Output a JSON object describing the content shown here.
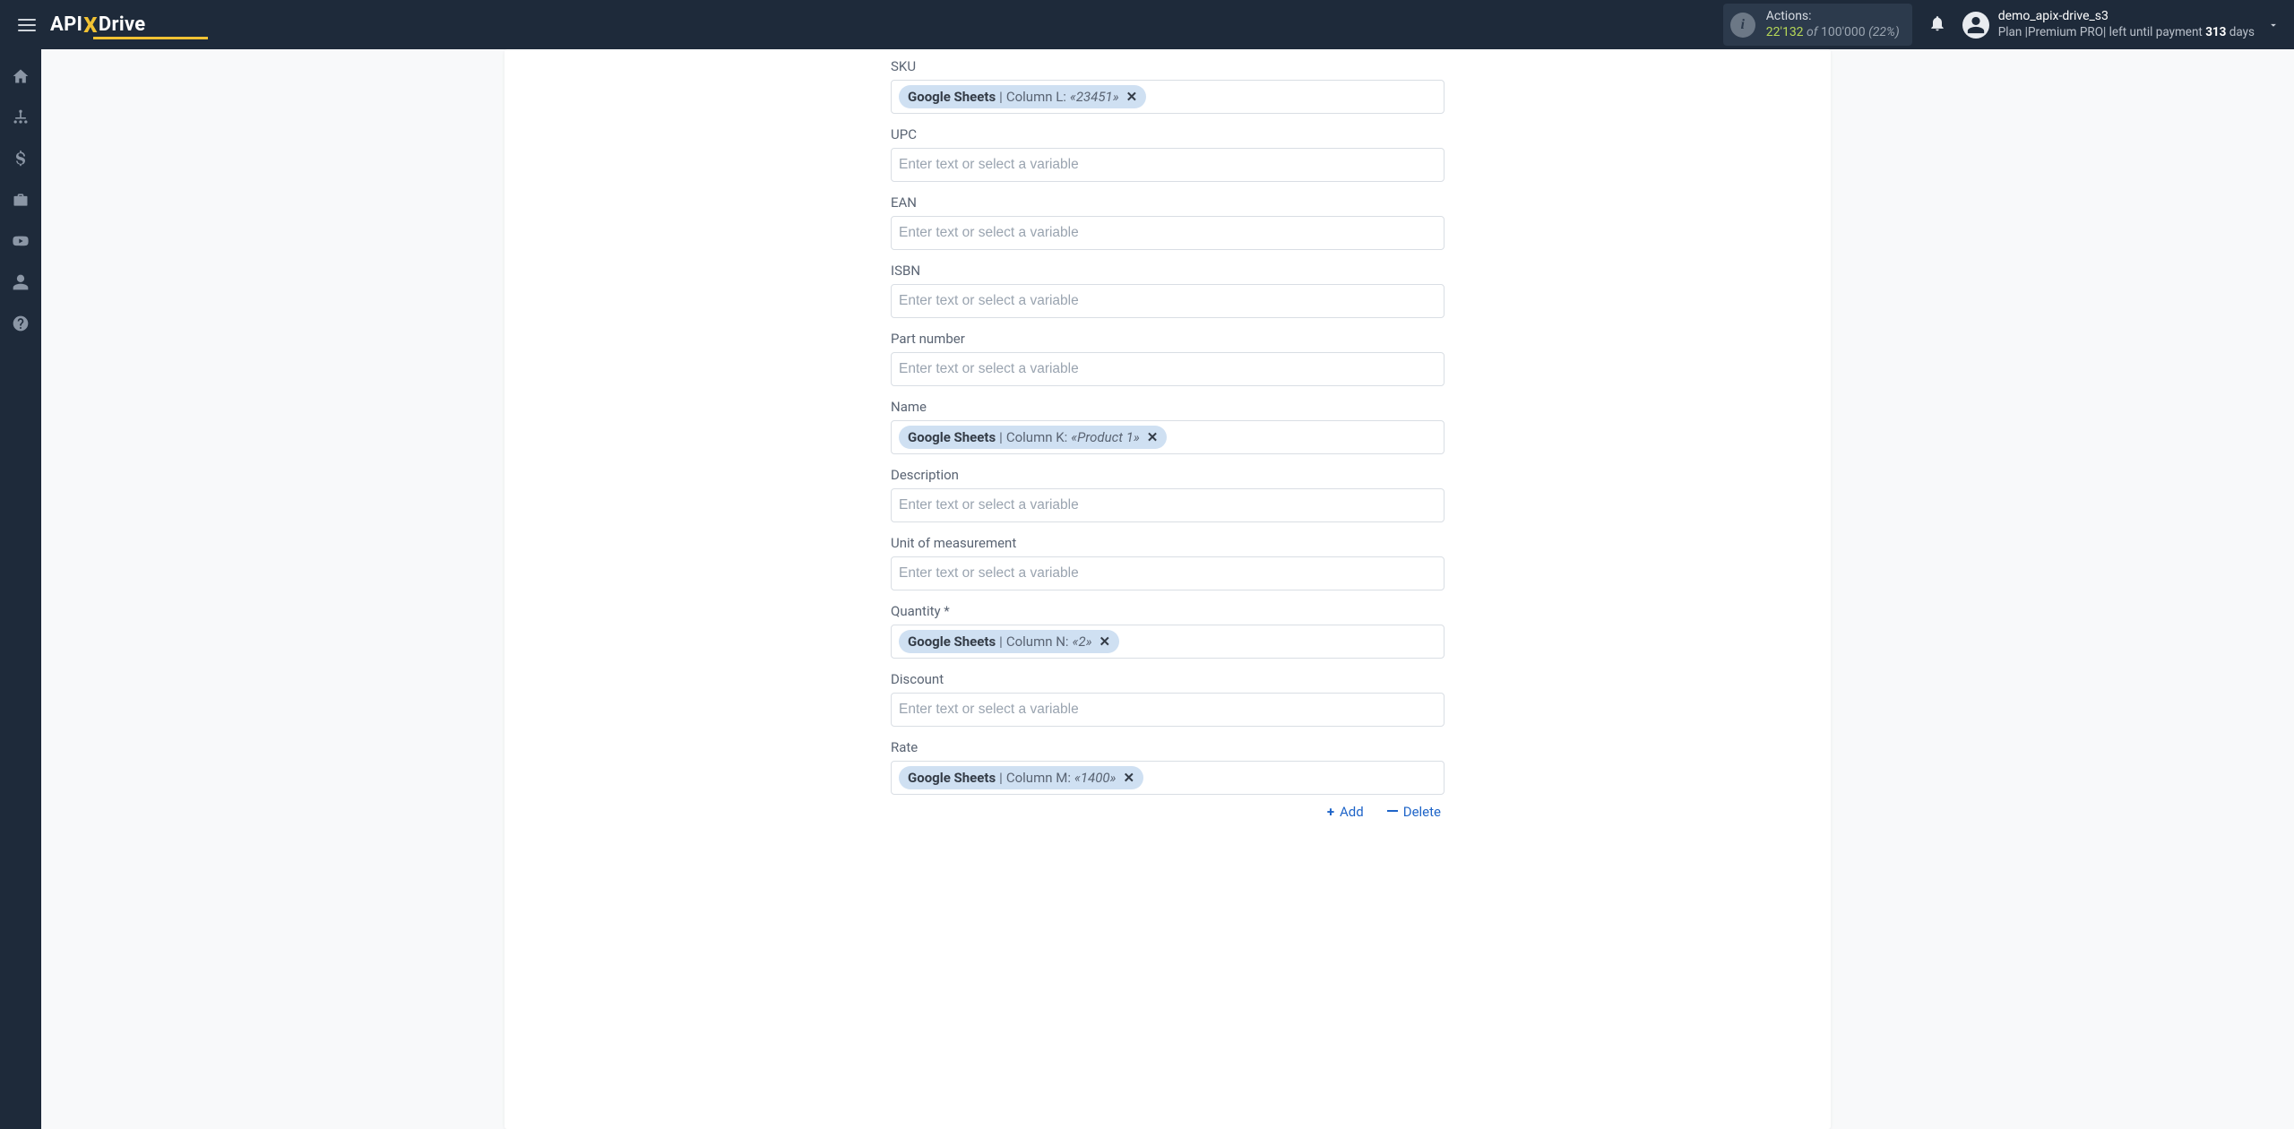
{
  "brand": {
    "part1": "API",
    "x": "X",
    "part2": "Drive"
  },
  "actions": {
    "label": "Actions:",
    "current": "22'132",
    "of": "of",
    "total": "100'000",
    "percent": "(22%)"
  },
  "user": {
    "name": "demo_apix-drive_s3",
    "plan_prefix": "Plan |Premium PRO| left until payment ",
    "days": "313",
    "plan_suffix": " days"
  },
  "placeholder": "Enter text or select a variable",
  "fields": [
    {
      "key": "sku",
      "label": "SKU",
      "chip": {
        "source": "Google Sheets",
        "column": "Column L:",
        "value": "«23451»"
      }
    },
    {
      "key": "upc",
      "label": "UPC"
    },
    {
      "key": "ean",
      "label": "EAN"
    },
    {
      "key": "isbn",
      "label": "ISBN"
    },
    {
      "key": "part_number",
      "label": "Part number"
    },
    {
      "key": "name",
      "label": "Name",
      "chip": {
        "source": "Google Sheets",
        "column": "Column K:",
        "value": "«Product 1»"
      }
    },
    {
      "key": "description",
      "label": "Description"
    },
    {
      "key": "unit",
      "label": "Unit of measurement"
    },
    {
      "key": "quantity",
      "label": "Quantity *",
      "chip": {
        "source": "Google Sheets",
        "column": "Column N:",
        "value": "«2»"
      }
    },
    {
      "key": "discount",
      "label": "Discount"
    },
    {
      "key": "rate",
      "label": "Rate",
      "chip": {
        "source": "Google Sheets",
        "column": "Column M:",
        "value": "«1400»"
      }
    }
  ],
  "buttons": {
    "add": "Add",
    "delete": "Delete"
  },
  "sidebar_icons": [
    "home",
    "sitemap",
    "dollar",
    "briefcase",
    "youtube",
    "user",
    "help"
  ]
}
